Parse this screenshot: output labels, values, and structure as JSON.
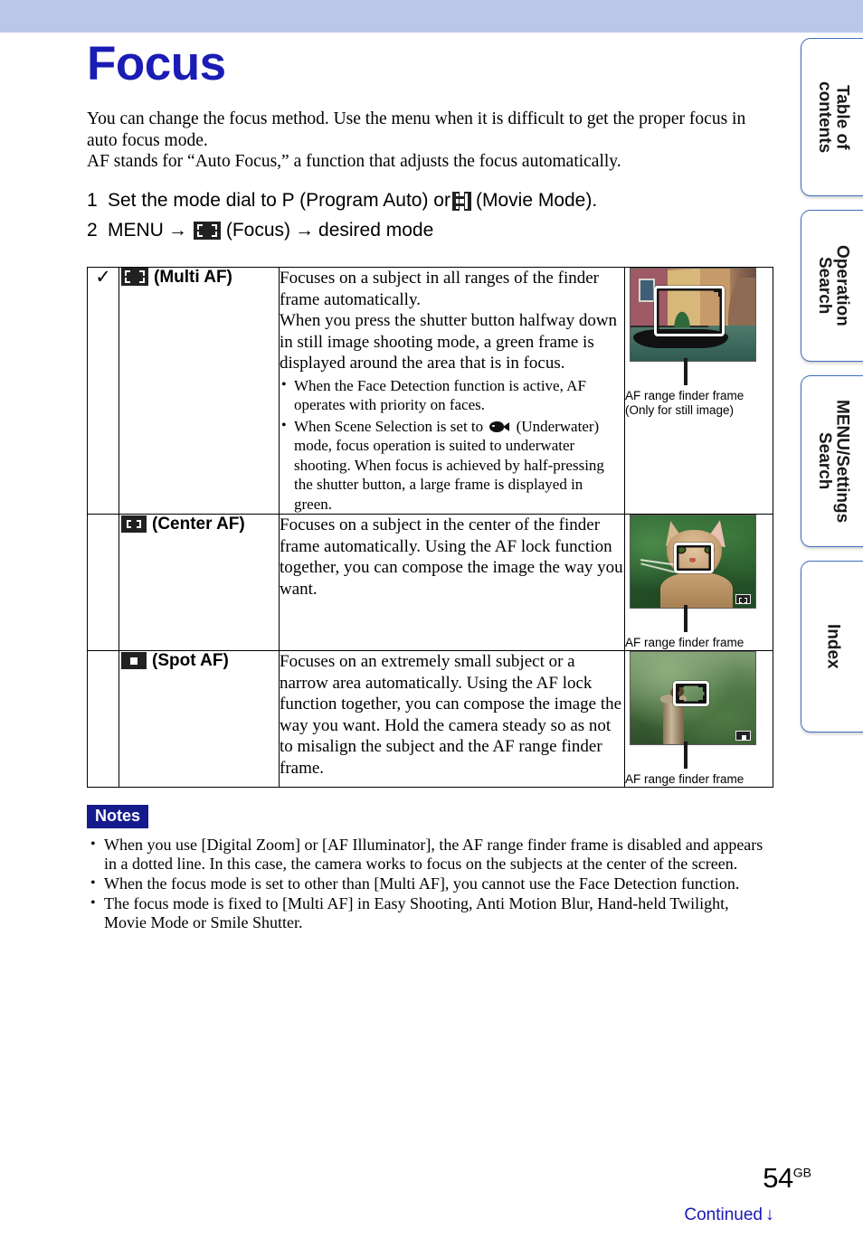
{
  "header": {
    "band_color": "#bbc6e8"
  },
  "sidebar": {
    "tabs": [
      {
        "label": "Table of\ncontents",
        "name": "table-of-contents"
      },
      {
        "label": "Operation\nSearch",
        "name": "operation-search"
      },
      {
        "label": "MENU/Settings\nSearch",
        "name": "menu-settings-search"
      },
      {
        "label": "Index",
        "name": "index"
      }
    ]
  },
  "page": {
    "title": "Focus",
    "title_color": "#1b1bb5",
    "intro": "You can change the focus method. Use the menu when it is difficult to get the proper focus in auto focus mode.\nAF stands for “Auto Focus,” a function that adjusts the focus automatically.",
    "steps": [
      {
        "number": "1",
        "part1": "Set the mode dial to P  (Program Auto) or",
        "icon": "film-strip-icon",
        "part2": "(Movie Mode)."
      },
      {
        "number": "2",
        "part1": "MENU",
        "arrow1": "→",
        "icon": "multi-af-icon",
        "part2": "(Focus)",
        "arrow2": "→",
        "part3": "desired mode"
      }
    ]
  },
  "table": {
    "rows": [
      {
        "checked": true,
        "check_glyph": "✓",
        "icon": "multi-af-icon",
        "mode": "(Multi AF)",
        "description": "Focuses on a subject in all ranges of the finder frame automatically.\nWhen you press the shutter button halfway down in still image shooting mode, a green frame is displayed around the area that is in focus.",
        "bullets": [
          {
            "text_before": "When the Face Detection function is active, AF operates with priority on faces.",
            "icon": null,
            "text_after": ""
          },
          {
            "text_before": "When Scene Selection is set to",
            "icon": "underwater-fish-icon",
            "text_after": "(Underwater) mode, focus operation is suited to underwater shooting. When focus is achieved by half-pressing the shutter button, a large frame is displayed in green."
          }
        ],
        "figure": {
          "photo": "venice-canal-gondola-photo",
          "caption": "AF range finder frame\n(Only for still image)"
        }
      },
      {
        "checked": false,
        "check_glyph": "",
        "icon": "center-af-icon",
        "mode": "(Center AF)",
        "description": "Focuses on a subject in the center of the finder frame automatically. Using the AF lock function together, you can compose the image the way you want.",
        "bullets": [],
        "figure": {
          "photo": "cat-photo",
          "caption": "AF range finder frame"
        }
      },
      {
        "checked": false,
        "check_glyph": "",
        "icon": "spot-af-icon",
        "mode": "(Spot AF)",
        "description": "Focuses on an extremely small subject or a narrow area automatically. Using the AF lock function together, you can compose the image the way you want. Hold the camera steady so as not to misalign the subject and the AF range finder frame.",
        "bullets": [],
        "figure": {
          "photo": "bird-on-stump-photo",
          "caption": "AF range finder frame"
        }
      }
    ]
  },
  "notes": {
    "label": "Notes",
    "label_bg": "#161b8c",
    "items": [
      "When you use [Digital Zoom] or [AF Illuminator], the AF range finder frame is disabled and appears in a dotted line. In this case, the camera works to focus on the subjects at the center of the screen.",
      "When the focus mode is set to other than [Multi AF], you cannot use the Face Detection function.",
      "The focus mode is fixed to [Multi AF] in Easy Shooting, Anti Motion Blur, Hand-held Twilight, Movie Mode or Smile Shutter."
    ]
  },
  "footer": {
    "page_number": "54",
    "page_suffix": "GB",
    "continued": "Continued",
    "continued_arrow": "↓",
    "continued_color": "#1b1bb5"
  }
}
